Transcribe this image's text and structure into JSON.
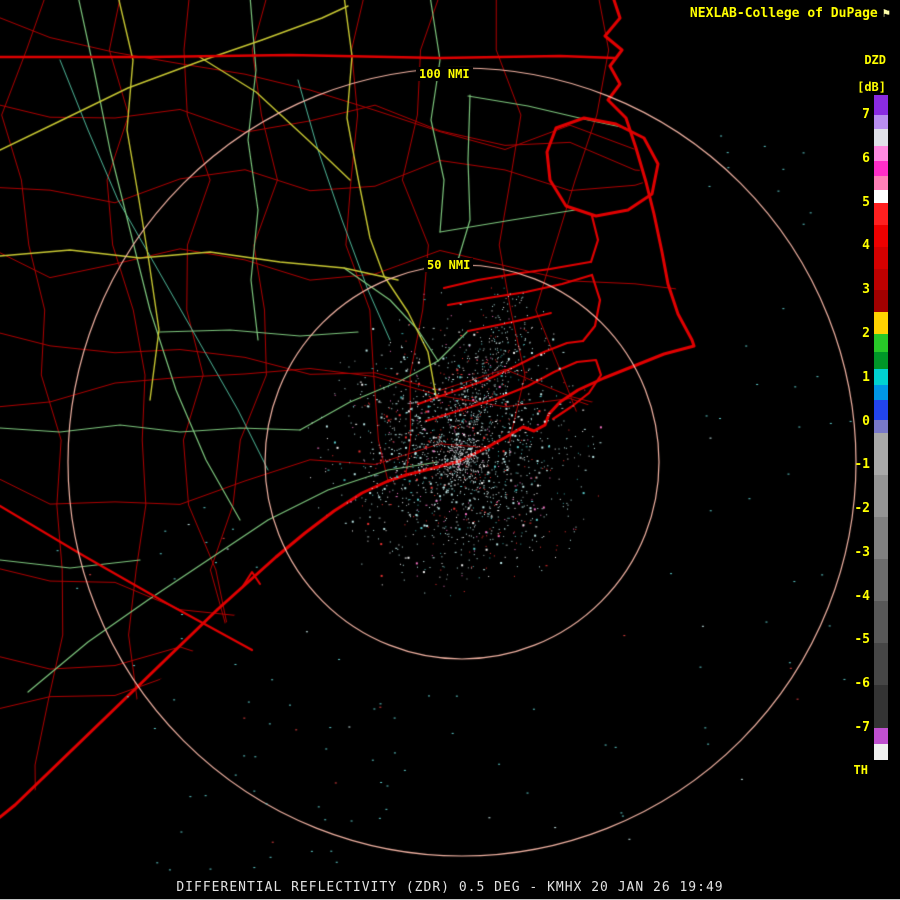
{
  "header": {
    "title": "NEXLAB-College of DuPage",
    "logo_glyph": "⚑"
  },
  "colorbar": {
    "product_label": "DZD",
    "units_label": "[dB]",
    "bottom_label": "TH",
    "ticks": [
      "7",
      "6",
      "5",
      "4",
      "3",
      "2",
      "1",
      "0",
      "-1",
      "-2",
      "-3",
      "-4",
      "-5",
      "-6",
      "-7"
    ],
    "segments": [
      {
        "h": 20,
        "c": "#8a2be2"
      },
      {
        "h": 14,
        "c": "#b98ef0"
      },
      {
        "h": 17,
        "c": "#e0e0e8"
      },
      {
        "h": 15,
        "c": "#ff8ae0"
      },
      {
        "h": 15,
        "c": "#ff2ec8"
      },
      {
        "h": 14,
        "c": "#ff80b8"
      },
      {
        "h": 13,
        "c": "#ffffff"
      },
      {
        "h": 22,
        "c": "#ff2020"
      },
      {
        "h": 22,
        "c": "#ee0000"
      },
      {
        "h": 22,
        "c": "#d40000"
      },
      {
        "h": 21,
        "c": "#bc0000"
      },
      {
        "h": 22,
        "c": "#a00000"
      },
      {
        "h": 22,
        "c": "#ffd200"
      },
      {
        "h": 18,
        "c": "#28c828"
      },
      {
        "h": 17,
        "c": "#009628"
      },
      {
        "h": 16,
        "c": "#00d2d2"
      },
      {
        "h": 15,
        "c": "#0096e6"
      },
      {
        "h": 20,
        "c": "#2244ee"
      },
      {
        "h": 13,
        "c": "#7878c8"
      },
      {
        "h": 42,
        "c": "#a8a8a8"
      },
      {
        "h": 42,
        "c": "#949494"
      },
      {
        "h": 42,
        "c": "#808080"
      },
      {
        "h": 42,
        "c": "#6c6c6c"
      },
      {
        "h": 42,
        "c": "#585858"
      },
      {
        "h": 42,
        "c": "#464646"
      },
      {
        "h": 43,
        "c": "#343434"
      },
      {
        "h": 16,
        "c": "#c050d0"
      },
      {
        "h": 16,
        "c": "#f0f0f0"
      }
    ]
  },
  "rings": {
    "label_100": "100 NMI",
    "label_50": "50 NMI"
  },
  "footer": {
    "caption": "DIFFERENTIAL REFLECTIVITY (ZDR) 0.5 DEG - KMHX 20 JAN 26 19:49"
  },
  "colors": {
    "background": "#000000",
    "label_text": "#ffff00",
    "footer_text": "#e2e2e2",
    "ring": "#f4b4a4",
    "coastline": "#e00000",
    "county_border": "#b00000",
    "road_primary": "#c8c832",
    "road_secondary": "#7ec87e",
    "river": "#4fb89a",
    "echo_palette": [
      "#b8e4e4",
      "#f0f0f0",
      "#9aa8a8",
      "#e83030",
      "#f070c0",
      "#58c8c8",
      "#3aa0a0"
    ]
  }
}
